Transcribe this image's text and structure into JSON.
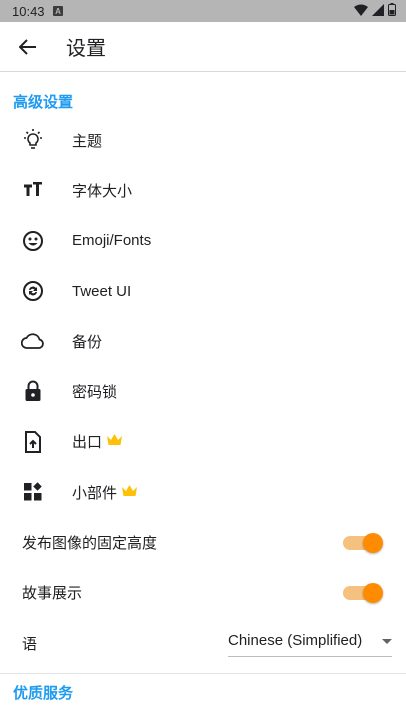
{
  "status_bar": {
    "time": "10:43",
    "notification_icon": "a-icon"
  },
  "app_bar": {
    "title": "设置"
  },
  "sections": {
    "advanced": {
      "title": "高级设置"
    },
    "premium": {
      "title": "优质服务"
    }
  },
  "items": [
    {
      "label": "主题",
      "icon": "lightbulb-icon"
    },
    {
      "label": "字体大小",
      "icon": "text-size-icon"
    },
    {
      "label": "Emoji/Fonts",
      "icon": "emoji-icon"
    },
    {
      "label": "Tweet UI",
      "icon": "sync-icon"
    },
    {
      "label": "备份",
      "icon": "cloud-icon"
    },
    {
      "label": "密码锁",
      "icon": "lock-icon"
    },
    {
      "label": "出口",
      "icon": "file-upload-icon",
      "premium": true
    },
    {
      "label": "小部件",
      "icon": "widgets-icon",
      "premium": true
    }
  ],
  "toggles": [
    {
      "label": "发布图像的固定高度",
      "on": true
    },
    {
      "label": "故事展示",
      "on": true
    }
  ],
  "language": {
    "label": "语",
    "value": "Chinese (Simplified)"
  },
  "colors": {
    "accent": "#1f9bf0",
    "switch_on": "#ff8c00",
    "switch_track": "#f6c07f",
    "crown": "#ffc107"
  }
}
